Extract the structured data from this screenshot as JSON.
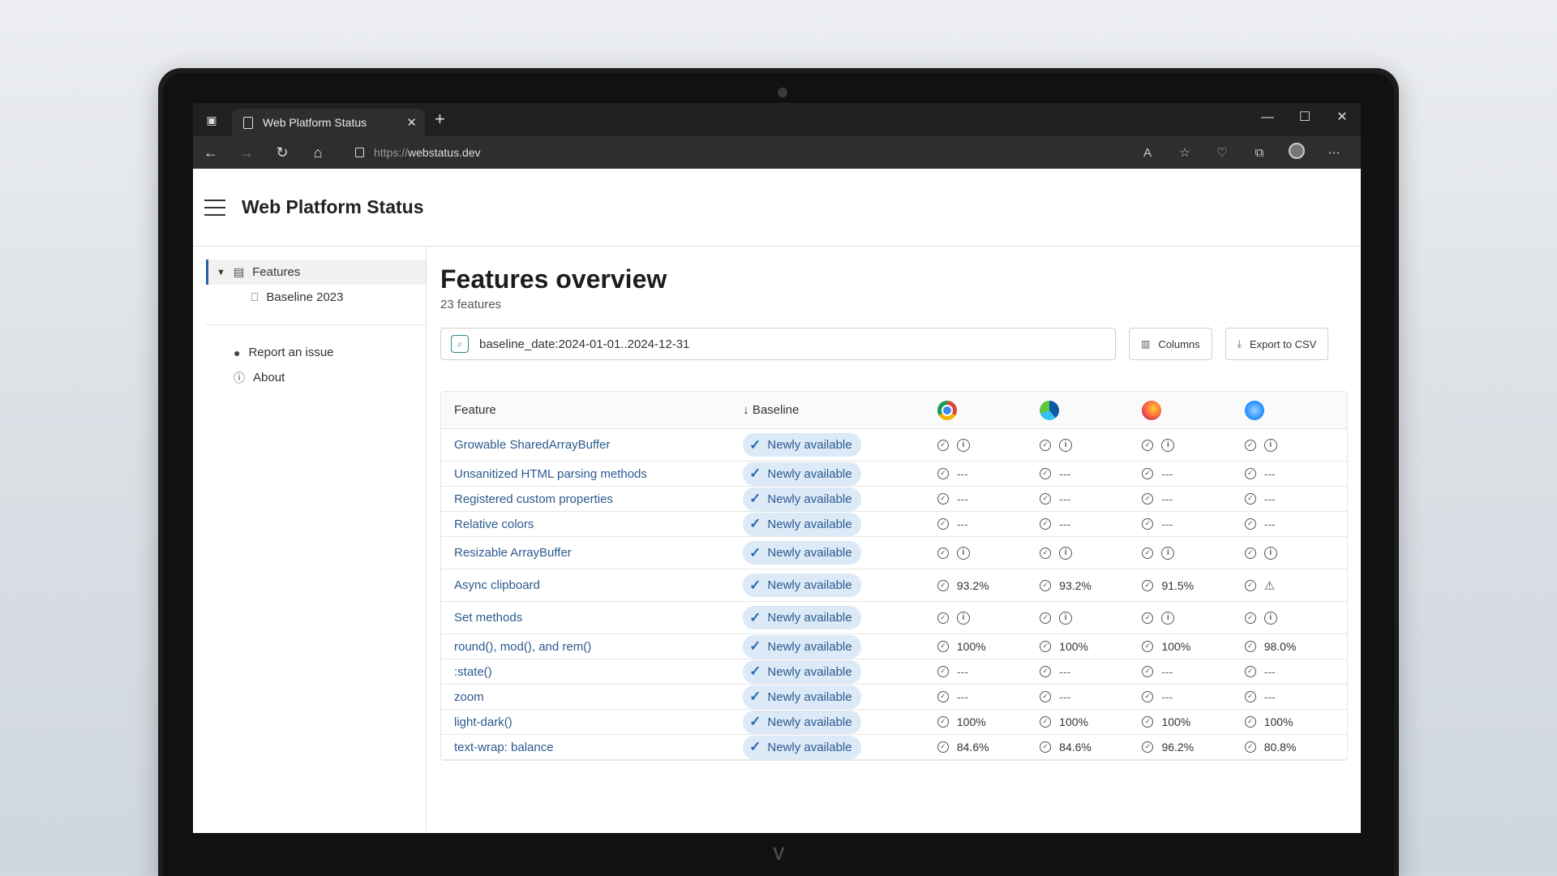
{
  "browser": {
    "tab_title": "Web Platform Status",
    "url_scheme": "https://",
    "url_host": "webstatus.dev",
    "new_tab": "+",
    "window_controls": [
      "minimize-icon",
      "maximize-icon",
      "close-icon"
    ]
  },
  "header": {
    "site_title": "Web Platform Status"
  },
  "sidebar": {
    "features_label": "Features",
    "baseline_label": "Baseline 2023",
    "report_label": "Report an issue",
    "about_label": "About"
  },
  "main": {
    "title": "Features overview",
    "count": "23 features",
    "search_value": "baseline_date:2024-01-01..2024-12-31",
    "columns_label": "Columns",
    "export_label": "Export to CSV"
  },
  "table": {
    "col_feature": "Feature",
    "col_baseline": "Baseline",
    "browsers": [
      "chrome",
      "edge",
      "firefox",
      "safari"
    ],
    "badge_label": "Newly available",
    "rows": [
      {
        "name": "Growable SharedArrayBuffer",
        "vals": [
          "i",
          "i",
          "i",
          "i"
        ]
      },
      {
        "name": "Unsanitized HTML parsing methods",
        "vals": [
          "---",
          "---",
          "---",
          "---"
        ]
      },
      {
        "name": "Registered custom properties",
        "vals": [
          "---",
          "---",
          "---",
          "---"
        ]
      },
      {
        "name": "Relative colors",
        "vals": [
          "---",
          "---",
          "---",
          "---"
        ]
      },
      {
        "name": "Resizable ArrayBuffer",
        "vals": [
          "i",
          "i",
          "i",
          "i"
        ]
      },
      {
        "name": "Async clipboard",
        "vals": [
          "93.2%",
          "93.2%",
          "91.5%",
          "warn"
        ]
      },
      {
        "name": "Set methods",
        "vals": [
          "i",
          "i",
          "i",
          "i"
        ]
      },
      {
        "name": "round(), mod(), and rem()",
        "vals": [
          "100%",
          "100%",
          "100%",
          "98.0%"
        ]
      },
      {
        "name": ":state()",
        "vals": [
          "---",
          "---",
          "---",
          "---"
        ]
      },
      {
        "name": "zoom",
        "vals": [
          "---",
          "---",
          "---",
          "---"
        ]
      },
      {
        "name": "light-dark()",
        "vals": [
          "100%",
          "100%",
          "100%",
          "100%"
        ]
      },
      {
        "name": "text-wrap: balance",
        "vals": [
          "84.6%",
          "84.6%",
          "96.2%",
          "80.8%"
        ]
      }
    ]
  }
}
